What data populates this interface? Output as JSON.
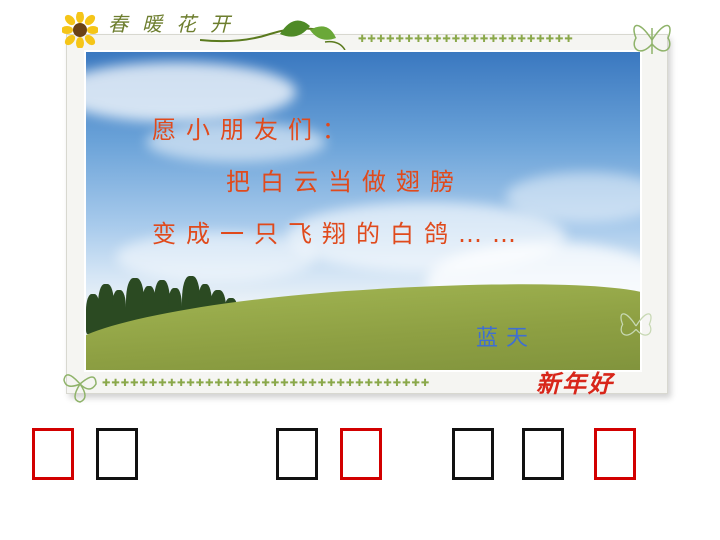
{
  "header": {
    "title": "春暖花开"
  },
  "poem": {
    "line1": "愿小朋友们：",
    "line2": "把白云当做翅膀",
    "line3": "变成一只飞翔的白鸽……",
    "signature": "蓝天",
    "greeting": "新年好"
  },
  "decorations": [
    "sunflower-icon",
    "vine-leaf-icon",
    "butterfly-icon"
  ],
  "colors": {
    "poem_text": "#e04a1c",
    "signature": "#3f6fd0",
    "greeting": "#d8261a",
    "box_red": "#d20000",
    "box_black": "#111111"
  },
  "answer_boxes": [
    {
      "group": 1,
      "color": "red"
    },
    {
      "group": 1,
      "color": "black"
    },
    {
      "group": 2,
      "color": "black"
    },
    {
      "group": 2,
      "color": "red"
    },
    {
      "group": 3,
      "color": "black"
    },
    {
      "group": 3,
      "color": "black"
    },
    {
      "group": 3,
      "color": "red"
    }
  ]
}
